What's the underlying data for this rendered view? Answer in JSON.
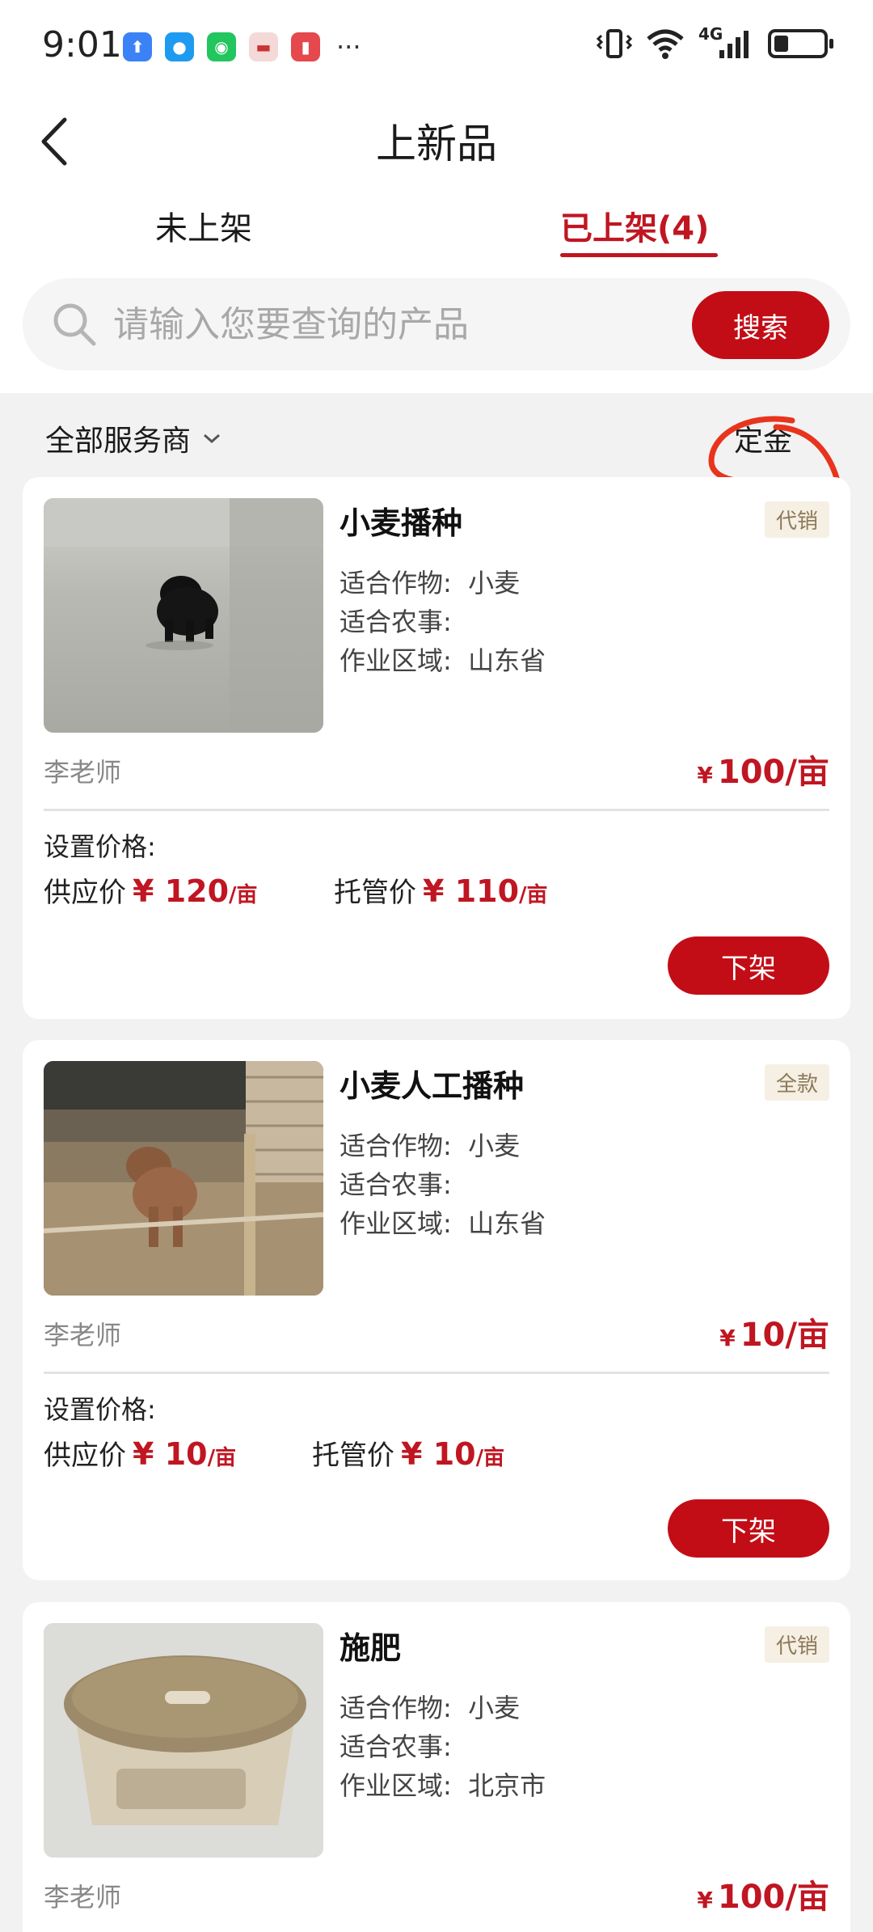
{
  "status_bar": {
    "time": "9:01",
    "more": "···",
    "network": "4G"
  },
  "header": {
    "title": "上新品"
  },
  "tabs": [
    {
      "label": "未上架",
      "active": false
    },
    {
      "label": "已上架(4)",
      "active": true
    }
  ],
  "search": {
    "placeholder": "请输入您要查询的产品",
    "button_label": "搜索"
  },
  "filter": {
    "provider_label": "全部服务商",
    "deposit_label": "定金"
  },
  "colors": {
    "accent": "#c30d16",
    "price": "#c01622"
  },
  "labels": {
    "crop": "适合作物:",
    "farm_work": "适合农事:",
    "region": "作业区域:",
    "set_price": "设置价格:",
    "supply_price": "供应价",
    "trust_price": "托管价",
    "off_shelf": "下架",
    "yen": "¥"
  },
  "products": [
    {
      "name": "小麦播种",
      "tag": "代销",
      "crop": "小麦",
      "farm_work": "",
      "region": "山东省",
      "provider": "李老师",
      "price": "100/亩",
      "supply_price": "120",
      "trust_price": "110",
      "unit": "/亩",
      "image": "black-puppy-photo"
    },
    {
      "name": "小麦人工播种",
      "tag": "全款",
      "crop": "小麦",
      "farm_work": "",
      "region": "山东省",
      "provider": "李老师",
      "price": "10/亩",
      "supply_price": "10",
      "trust_price": "10",
      "unit": "/亩",
      "image": "brown-puppy-photo"
    },
    {
      "name": "施肥",
      "tag": "代销",
      "crop": "小麦",
      "farm_work": "",
      "region": "北京市",
      "provider": "李老师",
      "price": "100/亩",
      "image": "stool-photo"
    }
  ]
}
